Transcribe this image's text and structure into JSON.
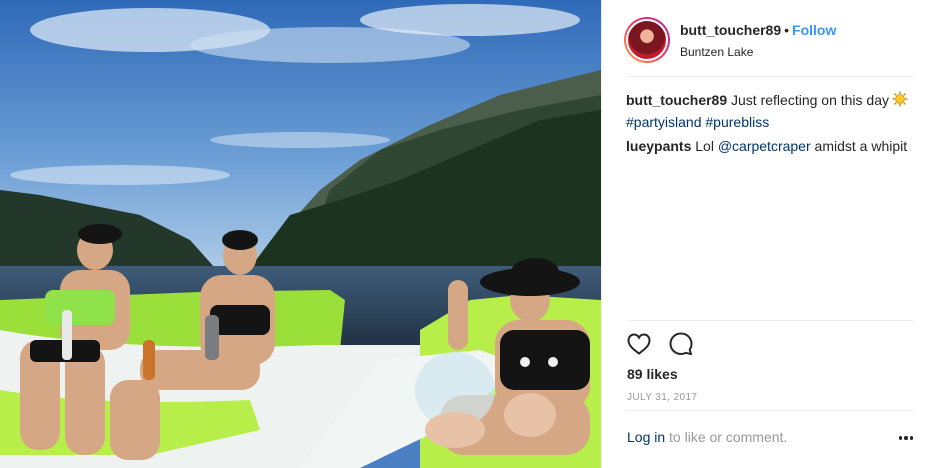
{
  "post": {
    "username": "butt_toucher89",
    "separator": "•",
    "follow_label": "Follow",
    "location": "Buntzen Lake",
    "caption": {
      "user": "butt_toucher89",
      "text": "Just reflecting on this day",
      "emoji": "sun-emoji",
      "tags": [
        "#partyisland",
        "#purebliss"
      ]
    },
    "comments": [
      {
        "user": "lueypants",
        "text_before": "Lol",
        "mention": "@carpetcraper",
        "text_after": "amidst a whipit"
      }
    ],
    "likes": "89 likes",
    "date": "JULY 31, 2017",
    "login": {
      "link": "Log in",
      "rest": "to like or comment."
    },
    "icons": {
      "like": "heart-icon",
      "comment": "comment-bubble-icon",
      "more": "more-options-icon"
    },
    "colors": {
      "link_blue": "#3897f0",
      "tag_blue": "#003569",
      "text": "#262626",
      "muted": "#999999"
    }
  }
}
